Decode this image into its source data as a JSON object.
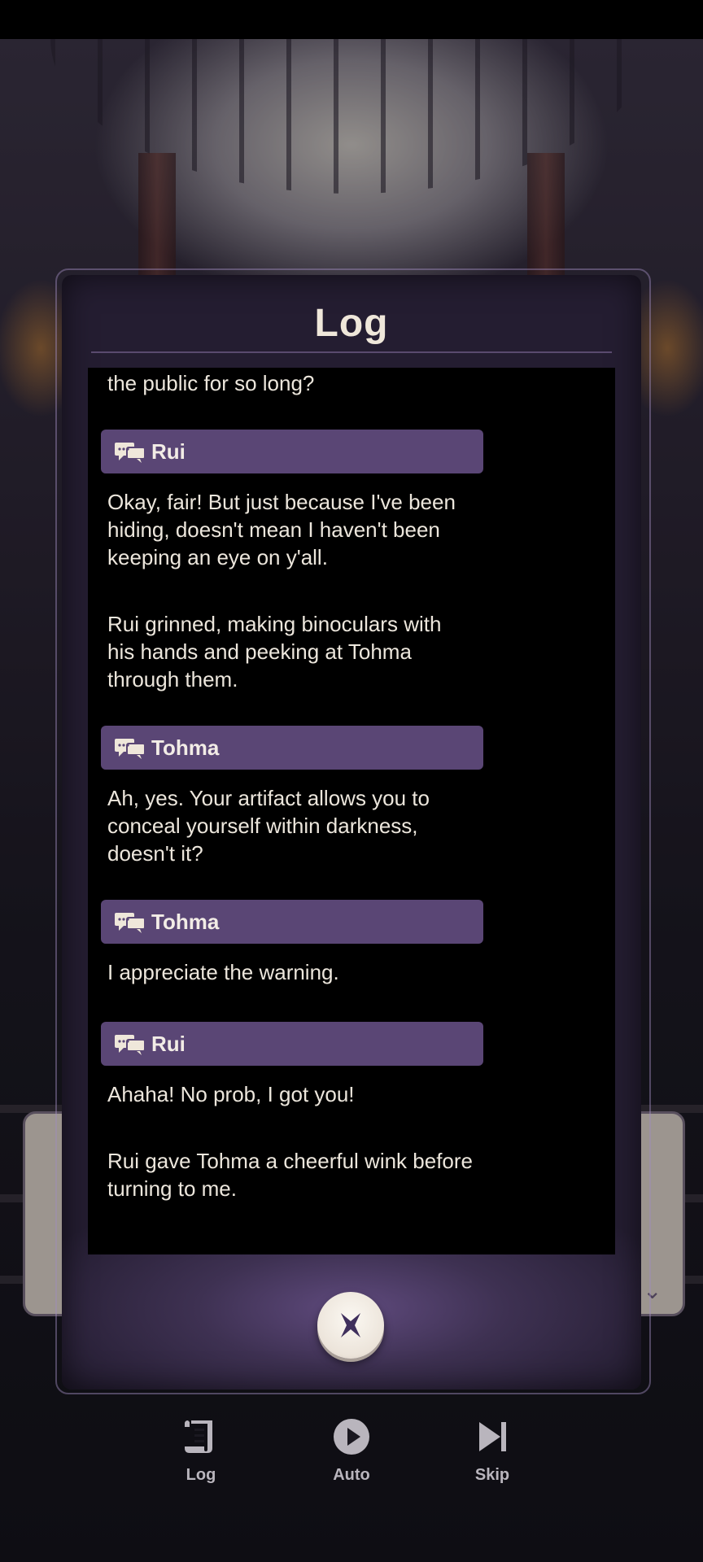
{
  "log_panel": {
    "title": "Log",
    "entries": [
      {
        "type": "narration",
        "text": "the public for so long?"
      },
      {
        "type": "speaker",
        "name": "Rui"
      },
      {
        "type": "dialogue",
        "text": "Okay, fair! But just because I've been hiding, doesn't mean I haven't been keeping an eye on y'all."
      },
      {
        "type": "narration",
        "text": "Rui grinned, making binoculars with his hands and peeking at Tohma through them."
      },
      {
        "type": "speaker",
        "name": "Tohma"
      },
      {
        "type": "dialogue",
        "text": "Ah, yes. Your artifact allows you to conceal yourself within darkness, doesn't it?"
      },
      {
        "type": "speaker",
        "name": "Tohma"
      },
      {
        "type": "dialogue",
        "text": "I appreciate the warning."
      },
      {
        "type": "speaker",
        "name": "Rui"
      },
      {
        "type": "dialogue",
        "text": "Ahaha! No prob, I got you!"
      },
      {
        "type": "narration",
        "text": "Rui gave Tohma a cheerful wink before turning to me."
      }
    ],
    "close_icon": "close-x-icon"
  },
  "bottom_bar": {
    "items": [
      {
        "label": "Log",
        "icon": "scroll-icon"
      },
      {
        "label": "Auto",
        "icon": "play-icon"
      },
      {
        "label": "Skip",
        "icon": "skip-forward-icon"
      }
    ]
  },
  "colors": {
    "accent_purple": "#5a4675",
    "panel_text": "#ece6dc",
    "title_text": "#efe7da",
    "log_background": "#000000"
  }
}
